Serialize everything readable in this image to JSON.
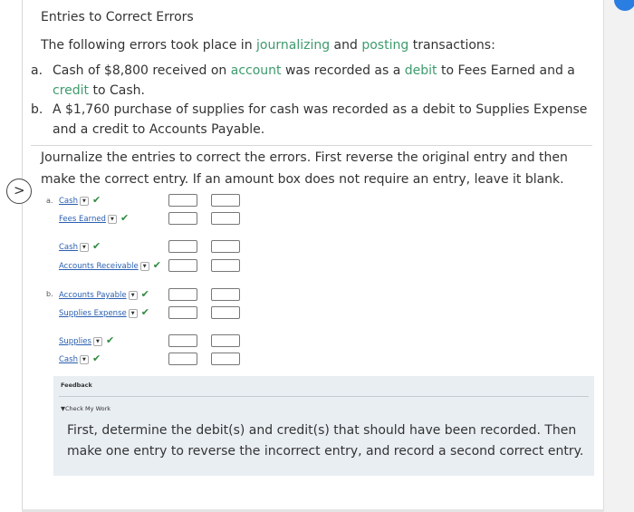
{
  "title": "Entries to Correct Errors",
  "intro": {
    "prefix": "The following errors took place in ",
    "link1": "journalizing",
    "mid": " and ",
    "link2": "posting",
    "suffix": " transactions:"
  },
  "errors": [
    {
      "label": "a.",
      "parts": [
        "Cash of $8,800 received on ",
        "account",
        " was recorded as a ",
        "debit",
        " to Fees Earned and a ",
        "credit",
        " to Cash."
      ]
    },
    {
      "label": "b.",
      "text": "A $1,760 purchase of supplies for cash was recorded as a debit to Supplies Expense and a credit to Accounts Payable."
    }
  ],
  "instructions": "Journalize the entries to correct the errors. First reverse the original entry and then make the correct entry. If an amount box does not require an entry, leave it blank.",
  "arrow_glyph": ">",
  "journal": {
    "a_label": "a.",
    "b_label": "b.",
    "rows": [
      {
        "account": "Cash"
      },
      {
        "account": "Fees Earned"
      },
      {
        "account": "Cash"
      },
      {
        "account": "Accounts Receivable"
      },
      {
        "account": "Accounts Payable"
      },
      {
        "account": "Supplies Expense"
      },
      {
        "account": "Supplies"
      },
      {
        "account": "Cash"
      }
    ],
    "check_glyph": "✔",
    "caret_glyph": "▼"
  },
  "feedback": {
    "header": "Feedback",
    "check_my_work": "▼Check My Work",
    "text": "First, determine the debit(s) and credit(s) that should have been recorded. Then make one entry to reverse the incorrect entry, and record a second correct entry."
  },
  "colors": {
    "link": "#3e9b6d",
    "account": "#2a5fb0",
    "check": "#2e8b3f",
    "feedback_bg": "#e9eef3"
  }
}
